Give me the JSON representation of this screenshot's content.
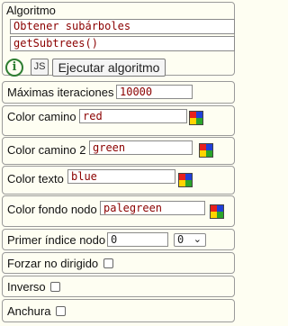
{
  "algorithm": {
    "title": "Algoritmo",
    "name_value": "Obtener subárboles",
    "function_value": "getSubtrees()",
    "info_icon_glyph": "i",
    "js_label": "JS",
    "run_label": "Ejecutar algoritmo"
  },
  "params": {
    "max_iterations": {
      "label": "Máximas iteraciones",
      "value": "10000"
    },
    "path_color": {
      "label": "Color camino",
      "value": "red"
    },
    "path_color_2": {
      "label": "Color camino 2",
      "value": "green"
    },
    "text_color": {
      "label": "Color texto",
      "value": "blue"
    },
    "node_bg_color": {
      "label": "Color fondo nodo",
      "value": "palegreen"
    },
    "first_node_index": {
      "label": "Primer índice nodo",
      "value": "0",
      "select_value": "0"
    },
    "force_undirected": {
      "label": "Forzar no dirigido"
    },
    "inverse": {
      "label": "Inverso"
    },
    "breadth": {
      "label": "Anchura"
    }
  },
  "colors": {
    "background": "#fefef2",
    "text_value": "#8b0000",
    "info_green": "#2e7d32",
    "picker": [
      "#e8201c",
      "#1f3fd8",
      "#ffd400",
      "#2aa52a"
    ]
  },
  "icons": {
    "info": "info-icon",
    "color_picker": "color-picker-icon",
    "dropdown": "chevron-down-icon"
  }
}
